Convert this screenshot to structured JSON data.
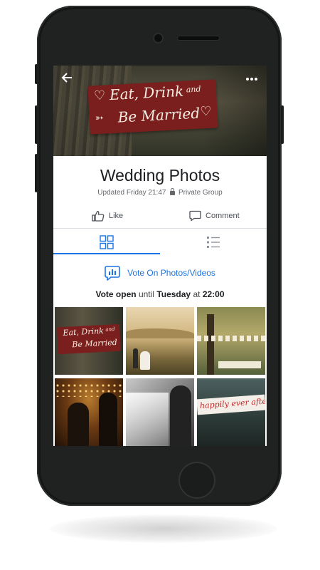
{
  "cover": {
    "sign_line1": "Eat, Drink",
    "sign_and": "and",
    "sign_line2": "Be Married",
    "back_icon": "arrow-left-icon",
    "more_icon": "more-horizontal-icon"
  },
  "group": {
    "title": "Wedding Photos",
    "updated": "Updated Friday 21:47",
    "privacy": "Private Group"
  },
  "actions": {
    "like": "Like",
    "comment": "Comment"
  },
  "tabs": [
    {
      "icon": "grid-view-icon",
      "active": true
    },
    {
      "icon": "list-view-icon",
      "active": false
    }
  ],
  "vote": {
    "label": "Vote On Photos/Videos",
    "status_open": "Vote open",
    "status_until": "until",
    "status_day": "Tuesday",
    "status_at": "at",
    "status_time": "22:00"
  },
  "photos": [
    {
      "sign_line1": "Eat, Drink",
      "sign_and": "and",
      "sign_line2": "Be Married"
    },
    {
      "caption": ""
    },
    {
      "caption": ""
    },
    {
      "caption": ""
    },
    {
      "caption": ""
    },
    {
      "sign_text": "happily ever after"
    }
  ],
  "colors": {
    "accent": "#1b74e4",
    "text_primary": "#1c1e21",
    "text_secondary": "#65676b",
    "phone_body": "#1f2220",
    "sign_red": "#7a1f1d"
  }
}
